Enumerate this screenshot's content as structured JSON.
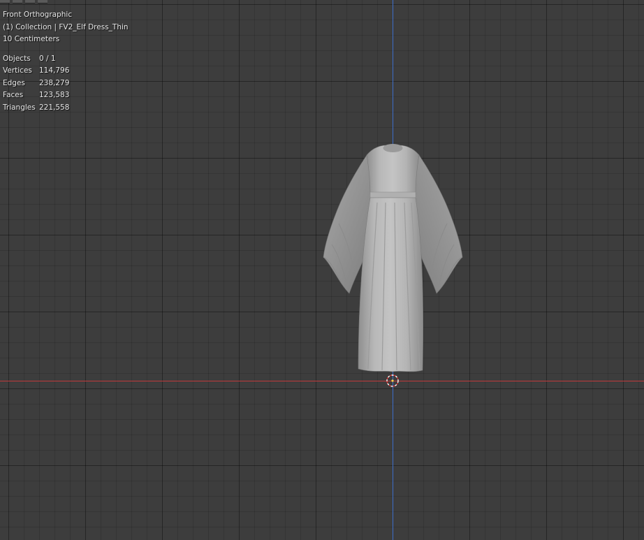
{
  "viewport": {
    "view_name": "Front Orthographic",
    "collection_info": "(1) Collection | FV2_Elf Dress_Thin",
    "grid_scale": "10 Centimeters",
    "stats": [
      {
        "key": "Objects",
        "value": "0 / 1"
      },
      {
        "key": "Vertices",
        "value": "114,796"
      },
      {
        "key": "Edges",
        "value": "238,279"
      },
      {
        "key": "Faces",
        "value": "123,583"
      },
      {
        "key": "Triangles",
        "value": "221,558"
      }
    ]
  },
  "colors": {
    "background": "#3d3d3d",
    "x_axis": "#c0393b",
    "z_axis": "#3d6ec9",
    "mesh": "#b4b4b4",
    "overlay_text": "#e6e6e6"
  },
  "icons": [
    "3d-cursor-icon"
  ]
}
